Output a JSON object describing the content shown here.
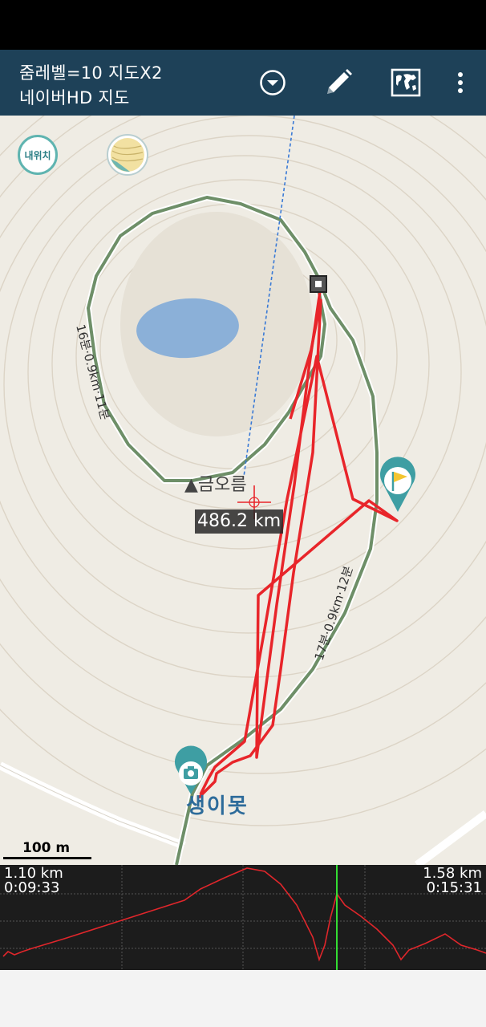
{
  "app_bar": {
    "zoom_line": "줌레벨=10 지도X2",
    "map_source": "네이버HD 지도",
    "icons": [
      "dropdown-circle-icon",
      "pencil-icon",
      "world-map-icon",
      "more-vert-icon"
    ]
  },
  "map": {
    "my_location_label": "내위치",
    "peak_label": "▲금오름",
    "pond_label": "생이못",
    "distance_readout": "486.2 km",
    "scale_label": "100 m",
    "trail_label_left": "16분·0.9km·11분",
    "trail_label_right": "17분·0.9km·12분",
    "colors": {
      "track": "#e8252a",
      "trail": "#6e8f68",
      "pond": "#8bb0d8",
      "pin": "#3e9ea3",
      "bearing_line": "#3a7ad6"
    }
  },
  "profile": {
    "left_distance": "1.10 km",
    "left_time": "0:09:33",
    "right_distance": "1.58 km",
    "right_time": "0:15:31",
    "colors": {
      "curve": "#e0262b",
      "cursor": "#33dd33",
      "grid": "#555555"
    }
  }
}
